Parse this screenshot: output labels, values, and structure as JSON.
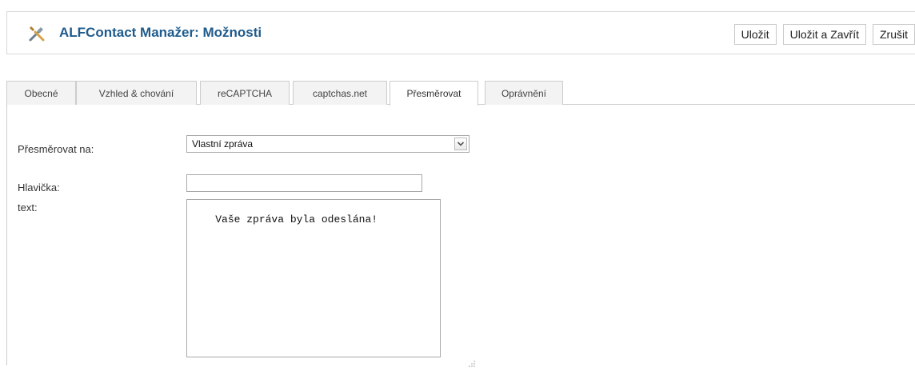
{
  "header": {
    "title": "ALFContact Manažer: Možnosti",
    "icon": "tools-icon"
  },
  "toolbar": {
    "save_label": "Uložit",
    "save_close_label": "Uložit a Zavřít",
    "cancel_label": "Zrušit"
  },
  "tabs": [
    {
      "label": "Obecné",
      "active": false
    },
    {
      "label": "Vzhled & chování",
      "active": false
    },
    {
      "label": "reCAPTCHA",
      "active": false
    },
    {
      "label": "captchas.net",
      "active": false
    },
    {
      "label": "Přesměrovat",
      "active": true
    },
    {
      "label": "Oprávnění",
      "active": false
    }
  ],
  "form": {
    "redirect_label": "Přesměrovat na:",
    "redirect_value": "Vlastní zpráva",
    "header_label": "Hlavička:",
    "header_value": "",
    "text_label": "text:",
    "text_value": "Vaše zpráva byla odeslána!"
  },
  "colors": {
    "title": "#1f5b8c",
    "border": "#cccccc",
    "tab_inactive_bg": "#f3f3f3"
  }
}
